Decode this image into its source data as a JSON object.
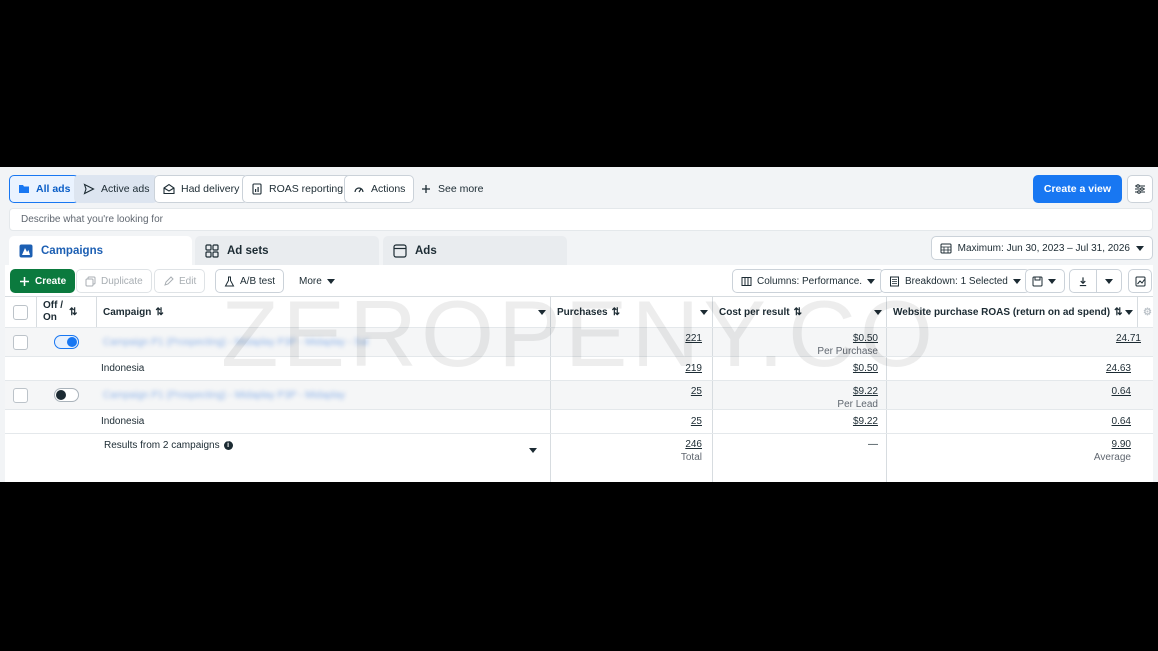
{
  "views": {
    "tabs": [
      {
        "label": "All ads",
        "icon": "folder-icon"
      },
      {
        "label": "Active ads",
        "icon": "send-icon"
      },
      {
        "label": "Had delivery",
        "icon": "mail-open-icon"
      },
      {
        "label": "ROAS reporting",
        "icon": "report-icon"
      },
      {
        "label": "Actions",
        "icon": "gauge-icon"
      },
      {
        "label": "See more",
        "icon": "plus-icon"
      }
    ],
    "create_view_label": "Create a view"
  },
  "search": {
    "placeholder": "Describe what you're looking for"
  },
  "levels": {
    "campaigns": "Campaigns",
    "ad_sets": "Ad sets",
    "ads": "Ads"
  },
  "date_range": {
    "label": "Maximum: Jun 30, 2023 – Jul 31, 2026"
  },
  "toolbar": {
    "create": "Create",
    "duplicate": "Duplicate",
    "edit": "Edit",
    "ab_test": "A/B test",
    "more": "More",
    "columns": "Columns: Performance.",
    "breakdown": "Breakdown: 1 Selected"
  },
  "table": {
    "headers": {
      "off_on_line1": "Off /",
      "off_on_line2": "On",
      "campaign": "Campaign",
      "purchases": "Purchases",
      "cost_per_result": "Cost per result",
      "roas": "Website purchase ROAS (return on ad spend)"
    },
    "rows": [
      {
        "campaign": "Campaign P1 (Prospecting) - Midaplay P3P - Midaplay - Sal",
        "purchases": "221",
        "cost": "$0.50",
        "cost_sub": "Per Purchase",
        "roas": "24.71",
        "toggle": "on"
      },
      {
        "campaign": "Indonesia",
        "purchases": "219",
        "cost": "$0.50",
        "cost_sub": "",
        "roas": "24.63"
      },
      {
        "campaign": "Campaign P1 (Prospecting) - Midaplay P3P - Midaplay",
        "purchases": "25",
        "cost": "$9.22",
        "cost_sub": "Per Lead",
        "roas": "0.64",
        "toggle": "off"
      },
      {
        "campaign": "Indonesia",
        "purchases": "25",
        "cost": "$9.22",
        "cost_sub": "",
        "roas": "0.64"
      }
    ],
    "summary": {
      "label": "Results from 2 campaigns",
      "purchases": "246",
      "purchases_sub": "Total",
      "cost": "—",
      "roas": "9.90",
      "roas_sub": "Average"
    }
  },
  "watermark": "ZEROPENY.CO"
}
